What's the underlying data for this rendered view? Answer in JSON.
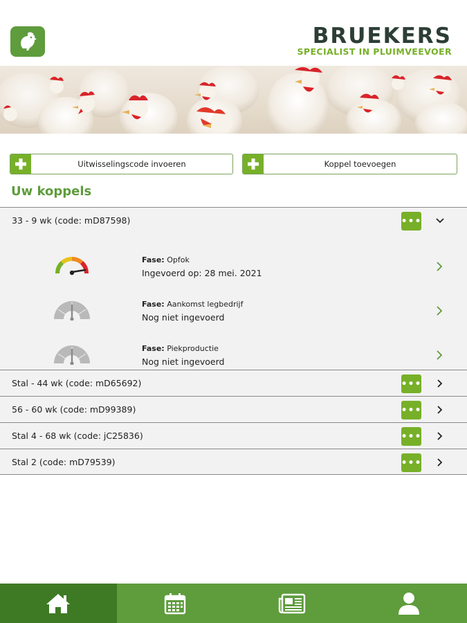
{
  "brand": {
    "name": "BRUEKERS",
    "tagline": "SPECIALIST IN PLUIMVEEVOER"
  },
  "actions": {
    "exchange_code": "Uitwisselingscode invoeren",
    "add_flock": "Koppel toevoegen"
  },
  "section_title": "Uw koppels",
  "flocks": [
    {
      "label": "33 - 9 wk (code: mD87598)",
      "expanded": true,
      "phases": [
        {
          "label_key": "Fase:",
          "name": "Opfok",
          "status": "Ingevoerd op: 28 mei. 2021",
          "gauge": "colored"
        },
        {
          "label_key": "Fase:",
          "name": "Aankomst legbedrijf",
          "status": "Nog niet ingevoerd",
          "gauge": "gray"
        },
        {
          "label_key": "Fase:",
          "name": "Piekproductie",
          "status": "Nog niet ingevoerd",
          "gauge": "gray"
        }
      ]
    },
    {
      "label": "Stal - 44 wk (code: mD65692)",
      "expanded": false
    },
    {
      "label": "56 - 60 wk (code: mD99389)",
      "expanded": false
    },
    {
      "label": "Stal 4 - 68 wk (code: jC25836)",
      "expanded": false
    },
    {
      "label": "Stal 2 (code: mD79539)",
      "expanded": false
    }
  ],
  "more_label": "•••",
  "nav": [
    {
      "icon": "home-icon",
      "active": true
    },
    {
      "icon": "calendar-icon",
      "active": false
    },
    {
      "icon": "newspaper-icon",
      "active": false
    },
    {
      "icon": "user-icon",
      "active": false
    }
  ],
  "colors": {
    "primary_green": "#5e9c3c",
    "accent_green": "#77b028",
    "nav_active": "#3e7a24",
    "brand_dark": "#2c3e35"
  }
}
